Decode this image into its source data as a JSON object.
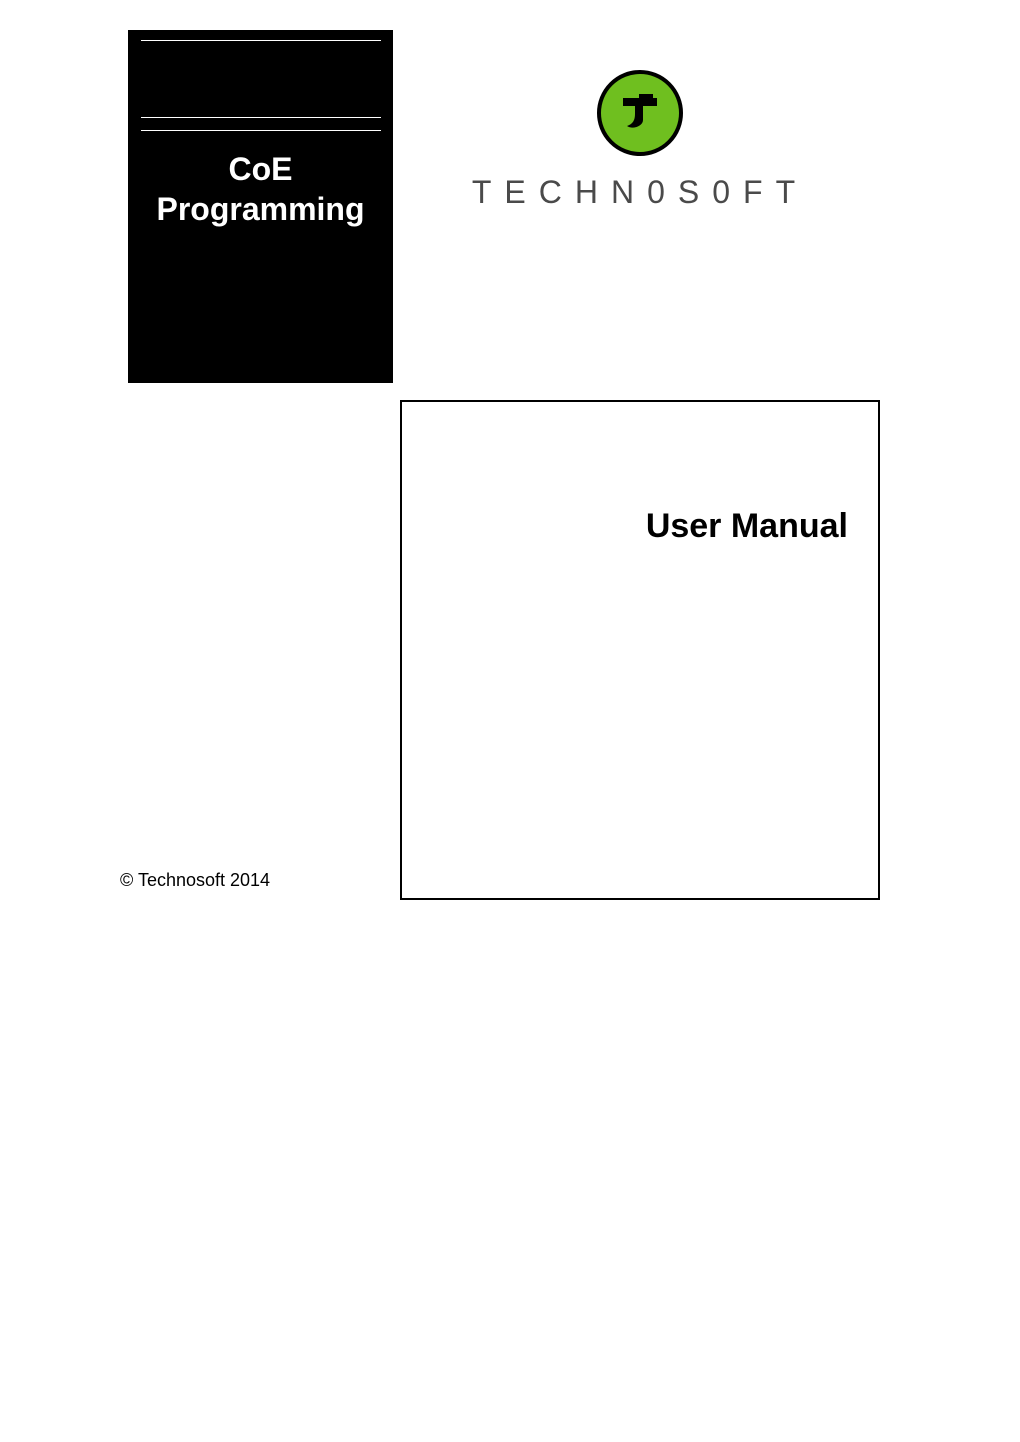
{
  "title_block": {
    "line1": "CoE",
    "line2": "Programming"
  },
  "brand": "TECHN0S0FT",
  "manual": {
    "title": "User Manual"
  },
  "copyright": "© Technosoft 2014"
}
